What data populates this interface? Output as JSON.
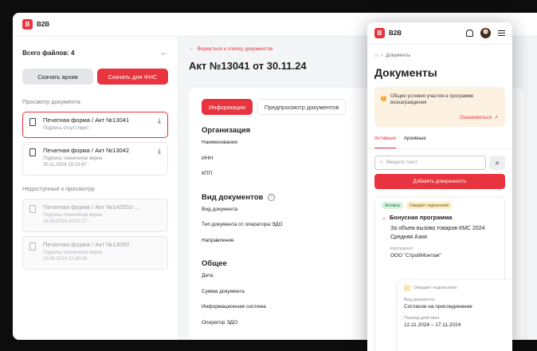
{
  "app": {
    "logo_letter": "B",
    "logo_text": "B2B"
  },
  "left_panel": {
    "files_total": "Всего файлов: 4",
    "download_archive": "Скачать архив",
    "download_fns": "Скачать для ФНС",
    "view_label": "Просмотр документа",
    "files": [
      {
        "name": "Печатная форма / Акт №13041",
        "status": "Подпись отсутствует",
        "date": ""
      },
      {
        "name": "Печатная форма / Акт №13042",
        "status": "Подпись технически верна",
        "date": "30.11.2024 10:13:47"
      }
    ],
    "unavailable_label": "Недоступные к просмотру",
    "unavailable_files": [
      {
        "name": "Печатная форма / Акт №142552-...",
        "status": "Подпись технически верна",
        "date": "16.06.2024 10:00:17"
      },
      {
        "name": "Печатная форма / Акт №13050",
        "status": "Подпись технически верна",
        "date": "15.06.2024 12:40:06"
      }
    ]
  },
  "main": {
    "back_link": "Вернуться к списку документов",
    "title": "Акт №13041 от 30.11.24",
    "tabs": {
      "info": "Информация",
      "preview": "Предпросмотр документов"
    },
    "sections": [
      {
        "title": "Организация",
        "fields": [
          "Наименование",
          "ИНН",
          "КПП"
        ]
      },
      {
        "title": "Вид документов",
        "fields": [
          "Вид документа",
          "Тип документа от оператора ЭДО",
          "Направление"
        ]
      },
      {
        "title": "Общее",
        "fields": [
          "Дата",
          "Сумма документа",
          "Информационная система",
          "Оператор ЭДО"
        ]
      }
    ]
  },
  "mobile": {
    "logo_letter": "B",
    "logo_text": "B2B",
    "breadcrumb": "Документы",
    "title": "Документы",
    "notice_text": "Общие условия участия в программе вознаграждения",
    "notice_link": "Ознакомиться",
    "tab_active": "Активные",
    "tab_other": "Архивные",
    "search_placeholder": "Введите текст",
    "add_button": "Добавить доверенность",
    "card": {
      "badge_active": "Активна",
      "badge_pending": "Ожидает подписания",
      "title": "Бонусная программа",
      "desc": "За объем вызова товаров КМС 2024 Средняя Азия",
      "contractor_label": "Контрагент",
      "contractor": "ООО \"СтройМонтаж\"",
      "sub": {
        "status": "Ожидает подписания",
        "doc_type_label": "Вид документа",
        "doc_type": "Согласие на присоединение",
        "period_label": "Период действия",
        "period": "12.11.2024 – 17.11.2024"
      }
    }
  }
}
